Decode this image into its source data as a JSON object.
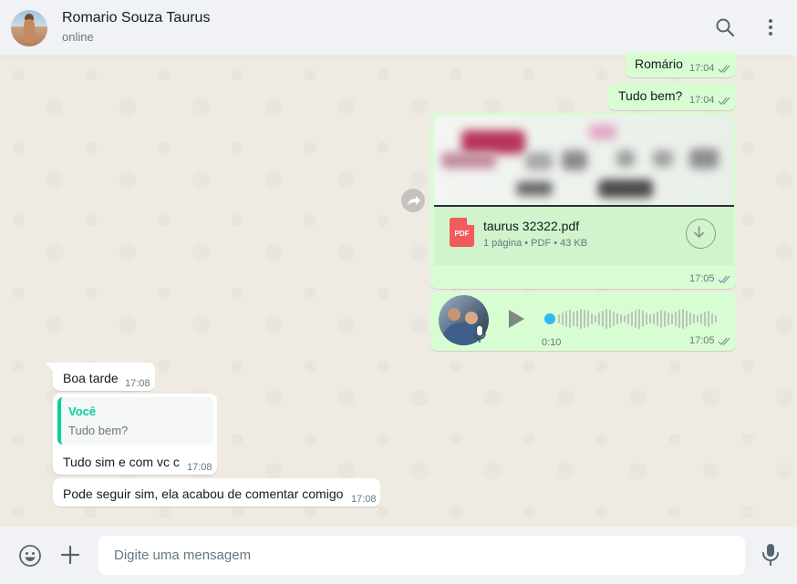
{
  "header": {
    "contact_name": "Romario Souza Taurus",
    "status": "online",
    "icons": [
      "search-icon",
      "menu-icon"
    ]
  },
  "messages": [
    {
      "direction": "out",
      "text": "Romário",
      "time": "17:04",
      "read": true
    },
    {
      "direction": "out",
      "text": "Tudo bem?",
      "time": "17:04",
      "read": true
    },
    {
      "direction": "out",
      "type": "document",
      "file_name": "taurus 32322.pdf",
      "file_type_badge": "PDF",
      "file_info": "1 página • PDF • 43 KB",
      "time": "17:05",
      "read": true
    },
    {
      "direction": "out",
      "type": "audio",
      "duration": "0:10",
      "time": "17:05",
      "read": true
    },
    {
      "direction": "in",
      "text": "Boa tarde",
      "time": "17:08"
    },
    {
      "direction": "in",
      "quoted_author": "Você",
      "quoted_text": "Tudo bem?",
      "text": "Tudo sim e com vc c",
      "time": "17:08"
    },
    {
      "direction": "in",
      "text": "Pode seguir sim, ela acabou de comentar comigo",
      "time": "17:08"
    }
  ],
  "composer": {
    "placeholder": "Digite uma mensagem",
    "icons": [
      "emoji-icon",
      "attach-plus-icon",
      "microphone-icon"
    ]
  },
  "colors": {
    "outgoing_bubble": "#d9fdd3",
    "incoming_bubble": "#ffffff",
    "read_ticks": "#53bdeb",
    "quote_accent": "#06cf9c",
    "audio_progress": "#34b7f1",
    "pdf_badge": "#f15b5b"
  }
}
